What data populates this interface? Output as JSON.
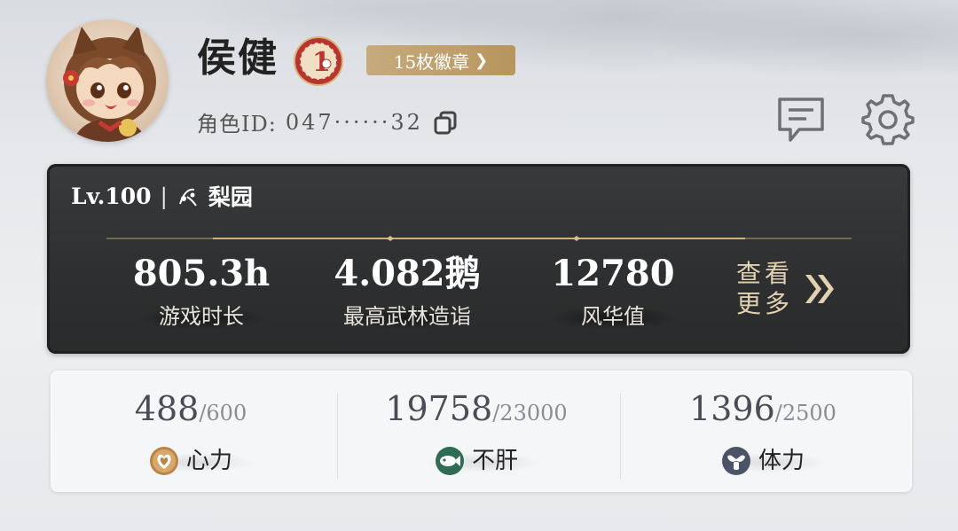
{
  "profile": {
    "name": "侯健",
    "rank_badge_text": "1",
    "badges_label": "15枚徽章",
    "badges_arrow": "❯",
    "role_id_label": "角色ID:",
    "role_id_value": "047······32"
  },
  "summary": {
    "level": "Lv.100",
    "separator": "|",
    "school": "梨园",
    "stats": [
      {
        "value": "805.3h",
        "label": "游戏时长"
      },
      {
        "value": "4.082鹅",
        "label": "最高武林造诣"
      },
      {
        "value": "12780",
        "label": "风华值"
      }
    ],
    "more_line1": "查看",
    "more_line2": "更多"
  },
  "resources": [
    {
      "current": "488",
      "max": "/600",
      "name": "心力",
      "icon": "heart-emblem-icon",
      "color": "#b8854a"
    },
    {
      "current": "19758",
      "max": "/23000",
      "name": "不肝",
      "icon": "fish-icon",
      "color": "#2f6b55"
    },
    {
      "current": "1396",
      "max": "/2500",
      "name": "体力",
      "icon": "muscle-icon",
      "color": "#4a5466"
    }
  ]
}
